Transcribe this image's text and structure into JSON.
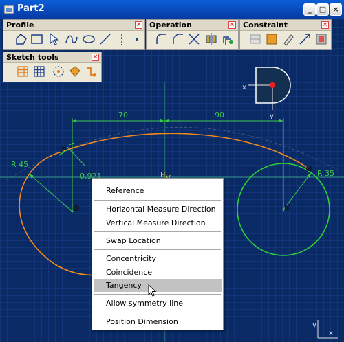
{
  "window": {
    "title": "Part2",
    "minimize_glyph": "_",
    "maximize_glyph": "□",
    "close_glyph": "×"
  },
  "toolbars": {
    "profile": {
      "title": "Profile",
      "close_glyph": "×"
    },
    "operation": {
      "title": "Operation",
      "close_glyph": "×"
    },
    "constraint": {
      "title": "Constraint",
      "close_glyph": "×"
    },
    "sketch_tools": {
      "title": "Sketch tools",
      "close_glyph": "×"
    }
  },
  "sketch": {
    "dim_left": "70",
    "dim_right": "90",
    "radius_left": "R 45",
    "radius_right": "R 35",
    "coefficient": "0.921",
    "axis_h": "H",
    "axis_v": "V",
    "compass_x": "x",
    "compass_y": "y",
    "corner_y": "y",
    "corner_x": "x"
  },
  "context_menu": {
    "items": [
      {
        "label": "Reference"
      },
      {
        "label": "Horizontal Measure Direction"
      },
      {
        "label": "Vertical Measure Direction"
      },
      {
        "label": "Swap Location"
      },
      {
        "label": "Concentricity"
      },
      {
        "label": "Coincidence"
      },
      {
        "label": "Tangency",
        "highlighted": true
      },
      {
        "label": "Allow symmetry line"
      },
      {
        "label": "Position Dimension"
      }
    ]
  },
  "colors": {
    "background": "#0a2a66",
    "grid": "#1c3e88",
    "profile_orange": "#f08a1e",
    "circle_green": "#2ed23a",
    "dimension_green": "#3ec84a",
    "axis_teal": "#3a9a8a",
    "titlebar": "#0847b8"
  },
  "icons": {
    "profile": [
      "polyline-icon",
      "rectangle-icon",
      "select-icon",
      "spline-icon",
      "ellipse-icon",
      "line-icon",
      "axis-icon",
      "point-icon"
    ],
    "operation": [
      "corner-icon",
      "chamfer-icon",
      "trim-icon",
      "mirror-icon",
      "offset-icon"
    ],
    "constraint": [
      "constraint-icon",
      "fix-icon",
      "edit-dimension-icon",
      "auto-dimension-icon",
      "animate-icon"
    ],
    "sketch_tools": [
      "grid-icon",
      "snap-grid-icon",
      "analysis-icon",
      "diagnostic-icon",
      "output-icon"
    ]
  }
}
